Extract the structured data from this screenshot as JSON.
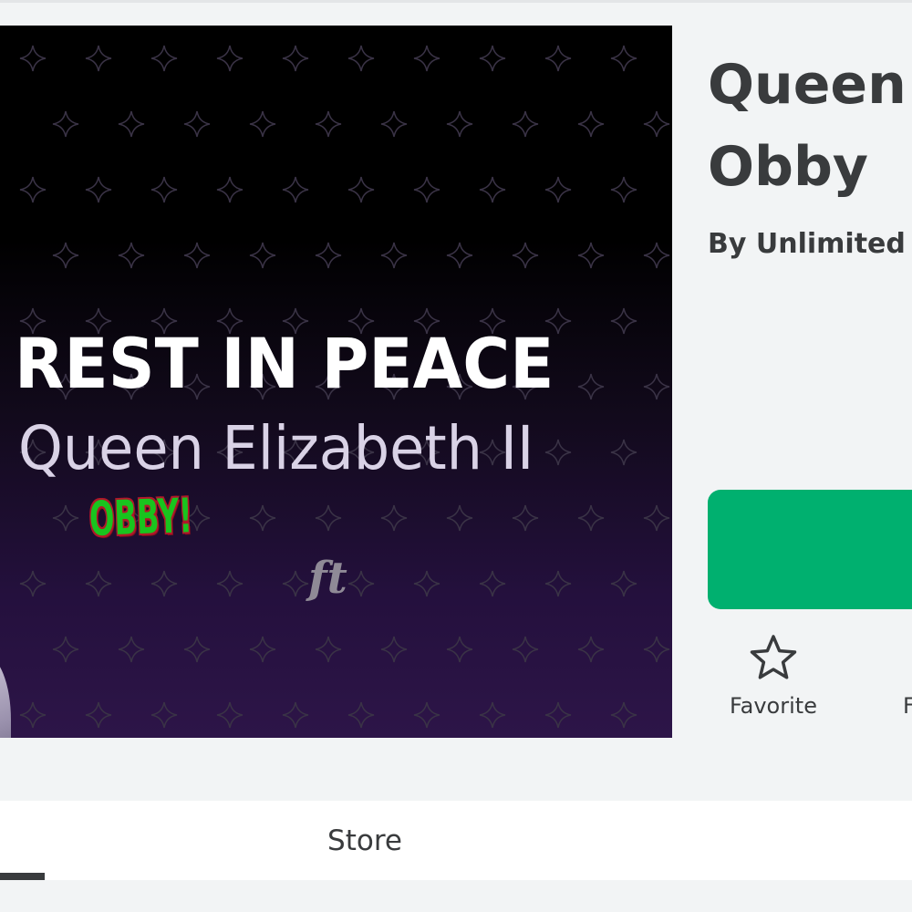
{
  "thumbnail": {
    "line1": "REST IN PEACE",
    "line2": "Queen Elizabeth II",
    "badge": "OBBY!",
    "logo": "ft"
  },
  "game": {
    "title_line1": "Queen",
    "title_line2": "Obby",
    "creator": "By Unlimited"
  },
  "play_button": {
    "color": "#00b06f",
    "icon": "play-icon"
  },
  "actions": [
    {
      "label": "Favorite",
      "icon": "star-outline-icon"
    },
    {
      "label": "F",
      "icon": ""
    }
  ],
  "tabs": [
    {
      "label": "",
      "active": true
    },
    {
      "label": "Store",
      "active": false
    }
  ],
  "colors": {
    "text": "#393b3d",
    "background": "#f2f4f5",
    "accent_green": "#00b06f"
  }
}
